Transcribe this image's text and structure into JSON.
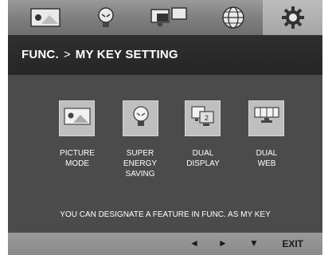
{
  "tabs": [
    {
      "icon": "picture-icon"
    },
    {
      "icon": "bulb-icon"
    },
    {
      "icon": "dual-display-icon"
    },
    {
      "icon": "globe-icon"
    },
    {
      "icon": "gear-icon",
      "active": true
    }
  ],
  "title": {
    "section": "FUNC.",
    "separator": ">",
    "page": "MY KEY SETTING"
  },
  "options": [
    {
      "icon": "picture-mode-icon",
      "line1": "PICTURE",
      "line2": "MODE",
      "line3": ""
    },
    {
      "icon": "super-energy-saving-icon",
      "line1": "SUPER",
      "line2": "ENERGY",
      "line3": "SAVING"
    },
    {
      "icon": "dual-display-option-icon",
      "line1": "DUAL",
      "line2": "DISPLAY",
      "line3": ""
    },
    {
      "icon": "dual-web-icon",
      "line1": "DUAL",
      "line2": "WEB",
      "line3": ""
    }
  ],
  "hint": "YOU CAN DESIGNATE A FEATURE IN FUNC. AS MY KEY",
  "bottom_bar": {
    "left_arrow": "◄",
    "right_arrow": "►",
    "down_arrow": "▼",
    "exit_label": "EXIT"
  },
  "colors": {
    "osd_background": "#4b4b4b",
    "title_bar": "#2a2a2a",
    "tab_bar": "#7d7d7d",
    "tile": "#bfbfbf"
  }
}
